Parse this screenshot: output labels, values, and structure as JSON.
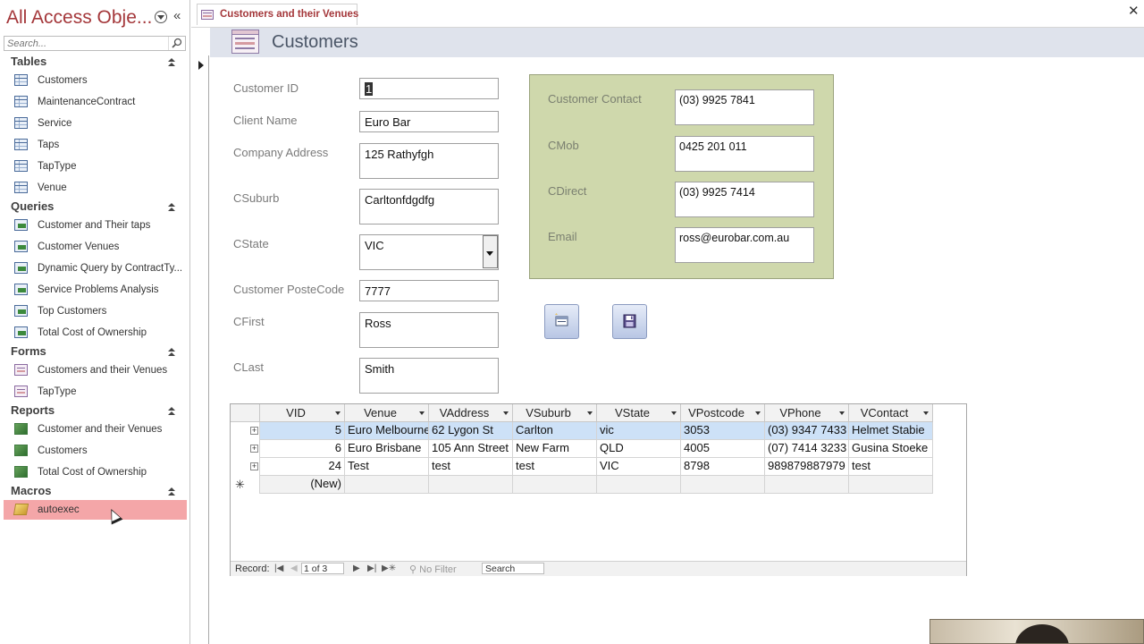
{
  "nav": {
    "title": "All Access Obje...",
    "search_placeholder": "Search...",
    "groups": {
      "tables": {
        "label": "Tables",
        "items": [
          "Customers",
          "MaintenanceContract",
          "Service",
          "Taps",
          "TapType",
          "Venue"
        ]
      },
      "queries": {
        "label": "Queries",
        "items": [
          "Customer and Their taps",
          "Customer Venues",
          "Dynamic Query by ContractTy...",
          "Service Problems Analysis",
          "Top Customers",
          "Total Cost of Ownership"
        ]
      },
      "forms": {
        "label": "Forms",
        "items": [
          "Customers and their Venues",
          "TapType"
        ]
      },
      "reports": {
        "label": "Reports",
        "items": [
          "Customer and their Venues",
          "Customers",
          "Total Cost of Ownership"
        ]
      },
      "macros": {
        "label": "Macros",
        "items": [
          "autoexec"
        ]
      }
    },
    "selected_item": "autoexec"
  },
  "document": {
    "tab_label": "Customers and their Venues",
    "close_glyph": "✕",
    "form_title": "Customers"
  },
  "form": {
    "fields": {
      "customer_id": {
        "label": "Customer ID",
        "value": "1"
      },
      "client_name": {
        "label": "Client Name",
        "value": "Euro Bar"
      },
      "company_address": {
        "label": "Company Address",
        "value": "125 Rathyfgh"
      },
      "csuburb": {
        "label": "CSuburb",
        "value": "Carltonfdgdfg"
      },
      "cstate": {
        "label": "CState",
        "value": "VIC"
      },
      "customer_postecode": {
        "label": "Customer PosteCode",
        "value": "7777"
      },
      "cfirst": {
        "label": "CFirst",
        "value": "Ross"
      },
      "clast": {
        "label": "CLast",
        "value": "Smith"
      }
    },
    "contact": {
      "customer_contact": {
        "label": "Customer Contact",
        "value": "(03) 9925 7841"
      },
      "cmob": {
        "label": "CMob",
        "value": "0425 201 011"
      },
      "cdirect": {
        "label": "CDirect",
        "value": "(03) 9925 7414"
      },
      "email": {
        "label": "Email",
        "value": "ross@eurobar.com.au"
      }
    },
    "panel_color": "#cfd8ac"
  },
  "subform": {
    "columns": [
      "VID",
      "Venue",
      "VAddress",
      "VSuburb",
      "VState",
      "VPostcode",
      "VPhone",
      "VContact"
    ],
    "rows": [
      [
        "5",
        "Euro Melbourne",
        "62 Lygon St",
        "Carlton",
        "vic",
        "3053",
        "(03) 9347 7433",
        "Helmet Stabie"
      ],
      [
        "6",
        "Euro Brisbane",
        "105 Ann Street",
        "New Farm",
        "QLD",
        "4005",
        "(07) 7414 3233",
        "Gusina Stoeke"
      ],
      [
        "24",
        "Test",
        "test",
        "test",
        "VIC",
        "8798",
        "989879887979",
        "test"
      ]
    ],
    "new_row_label": "(New)",
    "new_row_marker": "✳",
    "expand_glyph": "+",
    "record_nav": {
      "label": "Record:",
      "current": "1 of 3",
      "filter": "No Filter",
      "search": "Search"
    }
  },
  "colors": {
    "accent": "#a4373a",
    "selected_nav": "#f4a6a8",
    "active_row": "#cde1f7"
  }
}
